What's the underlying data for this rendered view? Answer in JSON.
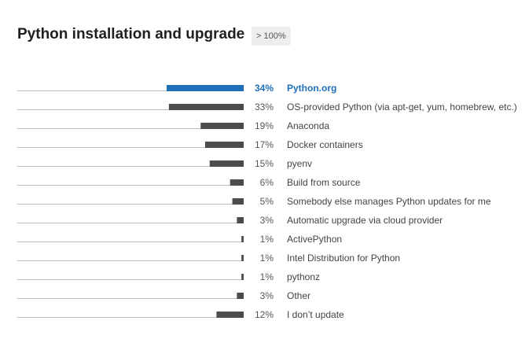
{
  "header": {
    "title": "Python installation and upgrade",
    "badge": "> 100%"
  },
  "colors": {
    "highlight": "#1f6fb8",
    "bar": "#4d4d4d",
    "baseline": "#bbbbbb"
  },
  "chart_data": {
    "type": "bar",
    "orientation": "horizontal",
    "title": "Python installation and upgrade",
    "highlight_index": 0,
    "xlim": [
      0,
      34
    ],
    "categories": [
      "Python.org",
      "OS-provided Python (via apt-get, yum, homebrew, etc.)",
      "Anaconda",
      "Docker containers",
      "pyenv",
      "Build from source",
      "Somebody else manages Python updates for me",
      "Automatic upgrade via cloud provider",
      "ActivePython",
      "Intel Distribution for Python",
      "pythonz",
      "Other",
      "I don’t update"
    ],
    "values": [
      34,
      33,
      19,
      17,
      15,
      6,
      5,
      3,
      1,
      1,
      1,
      3,
      12
    ],
    "value_labels": [
      "34%",
      "33%",
      "19%",
      "17%",
      "15%",
      "6%",
      "5%",
      "3%",
      "1%",
      "1%",
      "1%",
      "3%",
      "12%"
    ]
  }
}
